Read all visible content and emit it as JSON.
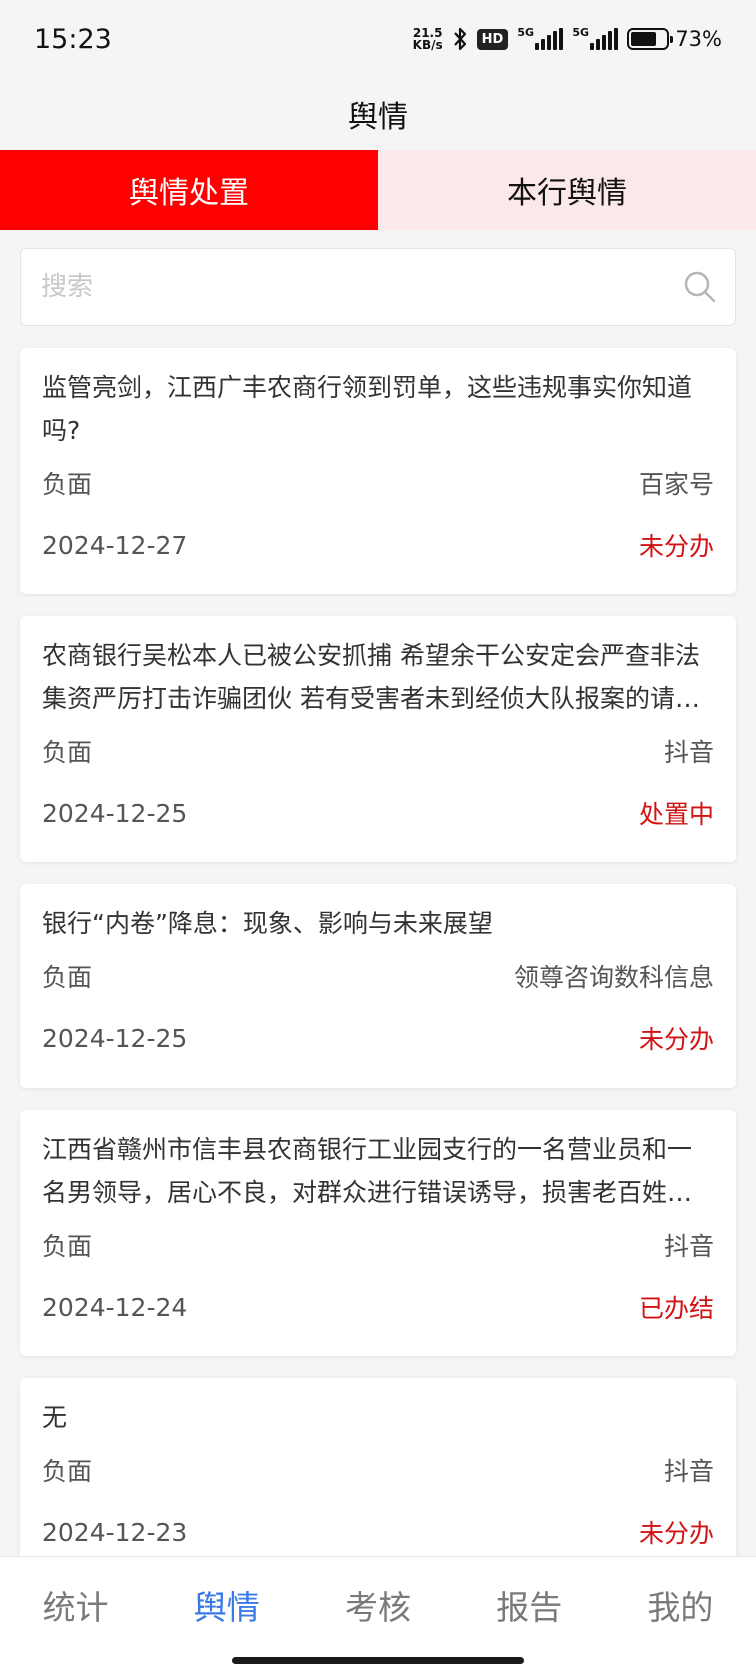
{
  "status_bar": {
    "time": "15:23",
    "net_speed_value": "21.5",
    "net_speed_unit": "KB/s",
    "hd_label": "HD",
    "sim1_label": "5G",
    "sim2_label": "5G",
    "battery_level": 0.73,
    "battery_text": "73%"
  },
  "header": {
    "title": "舆情"
  },
  "tabs": [
    {
      "label": "舆情处置",
      "active": true
    },
    {
      "label": "本行舆情",
      "active": false
    }
  ],
  "search": {
    "placeholder": "搜索",
    "value": ""
  },
  "items": [
    {
      "title": "监管亮剑，江西广丰农商行领到罚单，这些违规事实你知道吗?",
      "sentiment": "负面",
      "source": "百家号",
      "date": "2024-12-27",
      "status": "未分办"
    },
    {
      "title": "农商银行吴松本人已被公安抓捕 希望余干公安定会严查非法集资严厉打击诈骗团伙 若有受害者未到经侦大队报案的请尽快报案",
      "sentiment": "负面",
      "source": "抖音",
      "date": "2024-12-25",
      "status": "处置中"
    },
    {
      "title": "银行“内卷”降息：现象、影响与未来展望",
      "sentiment": "负面",
      "source": "领尊咨询数科信息",
      "date": "2024-12-25",
      "status": "未分办"
    },
    {
      "title": "江西省赣州市信丰县农商银行工业园支行的一名营业员和一名男领导，居心不良，对群众进行错误诱导，损害老百姓利益",
      "sentiment": "负面",
      "source": "抖音",
      "date": "2024-12-24",
      "status": "已办结"
    },
    {
      "title": "无",
      "sentiment": "负面",
      "source": "抖音",
      "date": "2024-12-23",
      "status": "未分办"
    }
  ],
  "tabbar": [
    {
      "label": "统计",
      "active": false
    },
    {
      "label": "舆情",
      "active": true
    },
    {
      "label": "考核",
      "active": false
    },
    {
      "label": "报告",
      "active": false
    },
    {
      "label": "我的",
      "active": false
    }
  ],
  "colors": {
    "accent_red": "#ff0000",
    "status_red": "#d21313",
    "tab_active_blue": "#3a7ae8"
  }
}
